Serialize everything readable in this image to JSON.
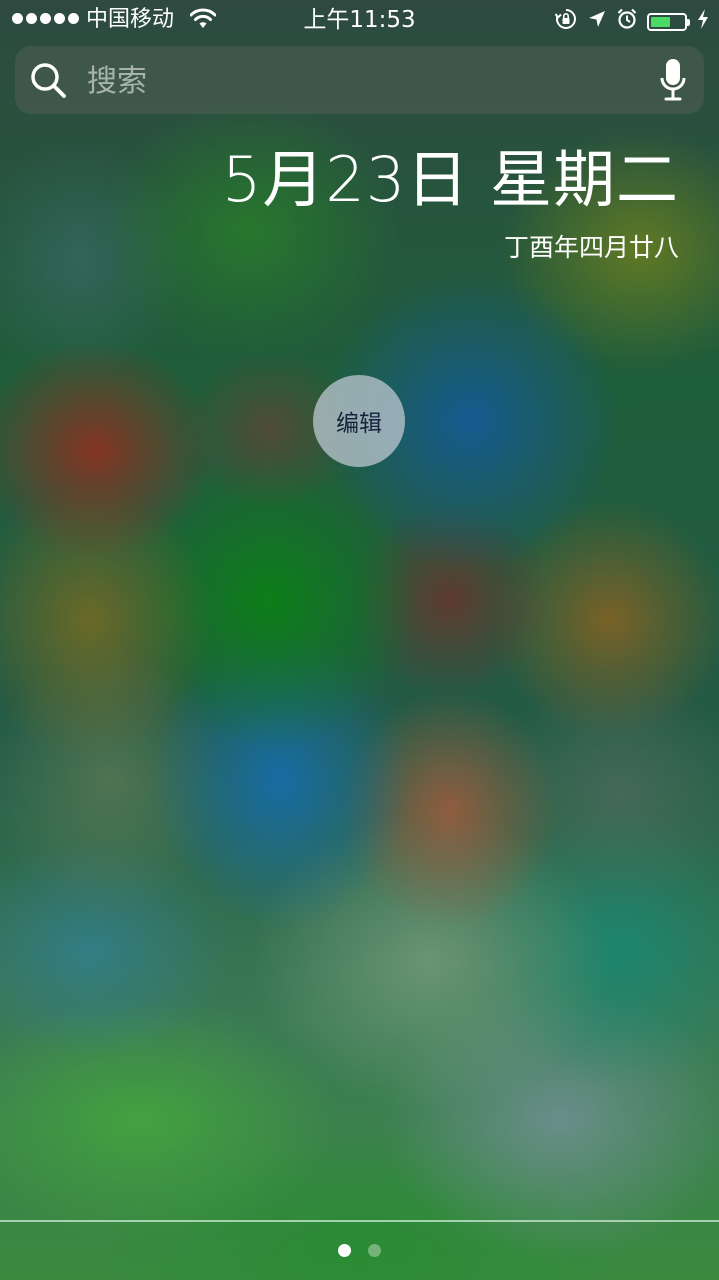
{
  "status_bar": {
    "carrier": "中国移动",
    "time": "上午11:53",
    "signal_bars": 5,
    "battery_level": 0.6,
    "battery_color": "#4cd964"
  },
  "search": {
    "placeholder": "搜索",
    "search_icon": "search-icon",
    "mic_icon": "microphone-icon"
  },
  "date": {
    "main": "5月23日 星期二",
    "lunar": "丁酉年四月廿八"
  },
  "edit_button": {
    "label": "编辑"
  },
  "page_indicator": {
    "count": 2,
    "active": 0
  }
}
